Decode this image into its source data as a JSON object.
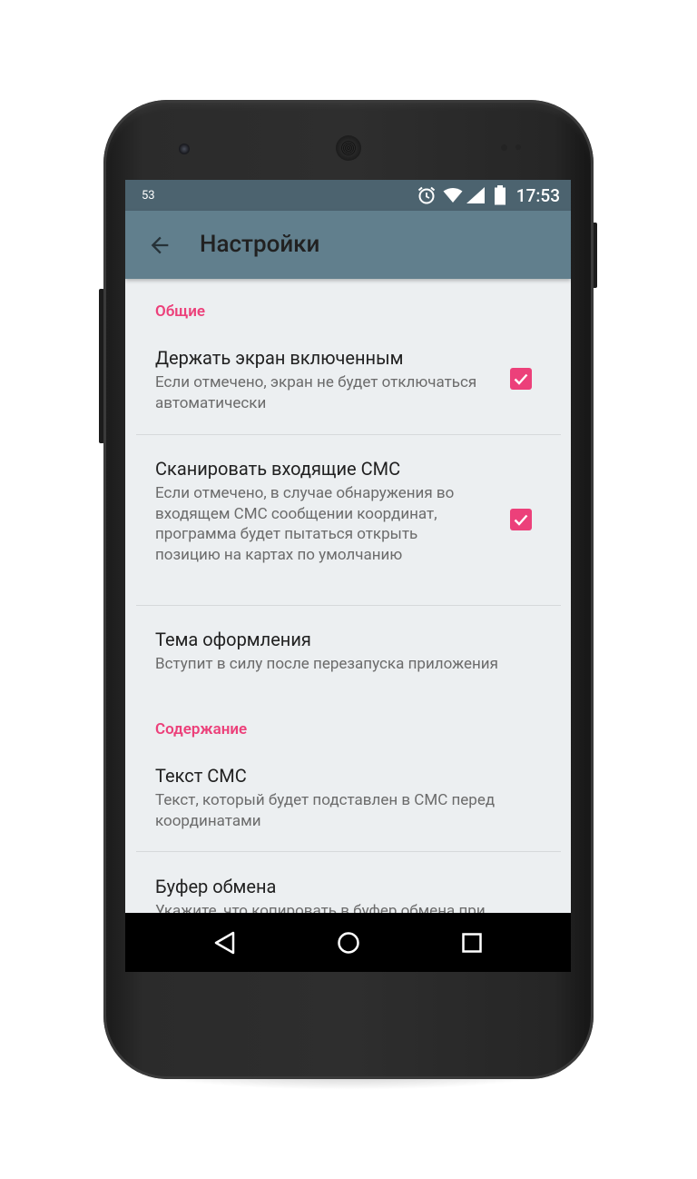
{
  "status_bar": {
    "notification_count": "53",
    "time": "17:53",
    "icons": [
      "alarm-icon",
      "wifi-icon",
      "signal-icon",
      "battery-icon"
    ]
  },
  "app_bar": {
    "title": "Настройки",
    "back_icon": "arrow-back-icon"
  },
  "sections": [
    {
      "title": "Общие",
      "items": [
        {
          "title": "Держать экран включенным",
          "summary": "Если отмечено, экран не будет отключаться автоматически",
          "checked": true
        },
        {
          "title": "Сканировать входящие СМС",
          "summary": "Если отмечено, в случае обнаружения во входящем СМС сообщении координат, программа будет пытаться открыть позицию на картах по умолчанию",
          "checked": true
        },
        {
          "title": "Тема оформления",
          "summary": "Вступит в силу после перезапуска приложения"
        }
      ]
    },
    {
      "title": "Содержание",
      "items": [
        {
          "title": "Текст СМС",
          "summary": "Текст, который будет подставлен в СМС перед координатами"
        },
        {
          "title": "Буфер обмена",
          "summary": "Укажите, что копировать в буфер обмена при"
        }
      ]
    }
  ],
  "nav_bar": {
    "buttons": [
      "back-triangle-icon",
      "home-circle-icon",
      "recents-square-icon"
    ]
  },
  "colors": {
    "accent": "#ec407a",
    "status_bar": "#4c636f",
    "app_bar": "#617f8d",
    "background": "#eceff1"
  }
}
